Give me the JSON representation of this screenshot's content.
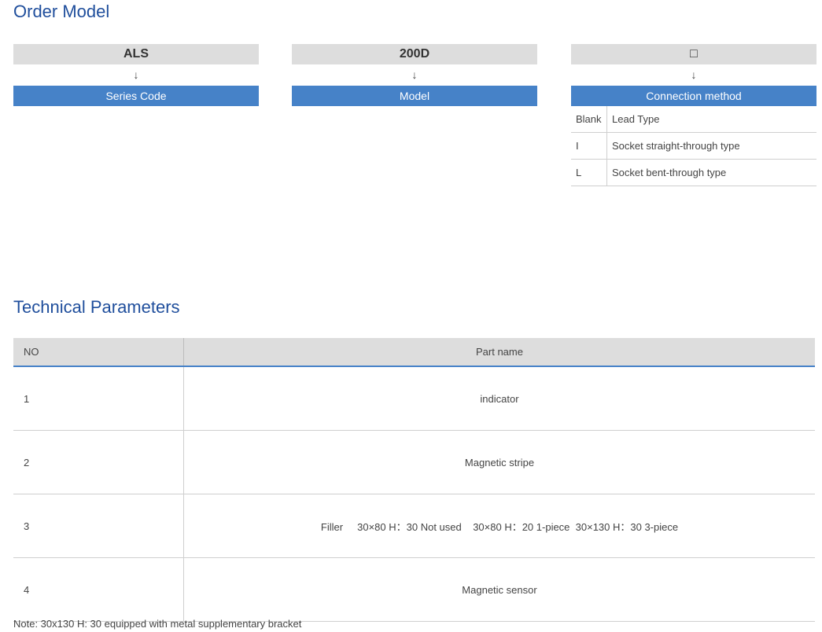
{
  "order_model": {
    "title": "Order Model",
    "columns": [
      {
        "code": "ALS",
        "arrow": "↓",
        "label": "Series Code"
      },
      {
        "code": "200D",
        "arrow": "↓",
        "label": "Model"
      },
      {
        "code": "□",
        "arrow": "↓",
        "label": "Connection method"
      }
    ],
    "connection_options": [
      {
        "key": "Blank",
        "value": "Lead Type"
      },
      {
        "key": "I",
        "value": "Socket straight-through type"
      },
      {
        "key": "L",
        "value": "Socket bent-through type"
      }
    ]
  },
  "technical_parameters": {
    "title": "Technical Parameters",
    "headers": {
      "no": "NO",
      "part": "Part name"
    },
    "rows": [
      {
        "no": "1",
        "part": "indicator"
      },
      {
        "no": "2",
        "part": "Magnetic stripe"
      },
      {
        "no": "3",
        "part": "Filler     30×80 H：30 Not used    30×80 H：20 1-piece  30×130 H：30 3-piece"
      },
      {
        "no": "4",
        "part": "Magnetic sensor"
      }
    ],
    "note": "Note: 30x130 H: 30 equipped with metal supplementary bracket"
  }
}
